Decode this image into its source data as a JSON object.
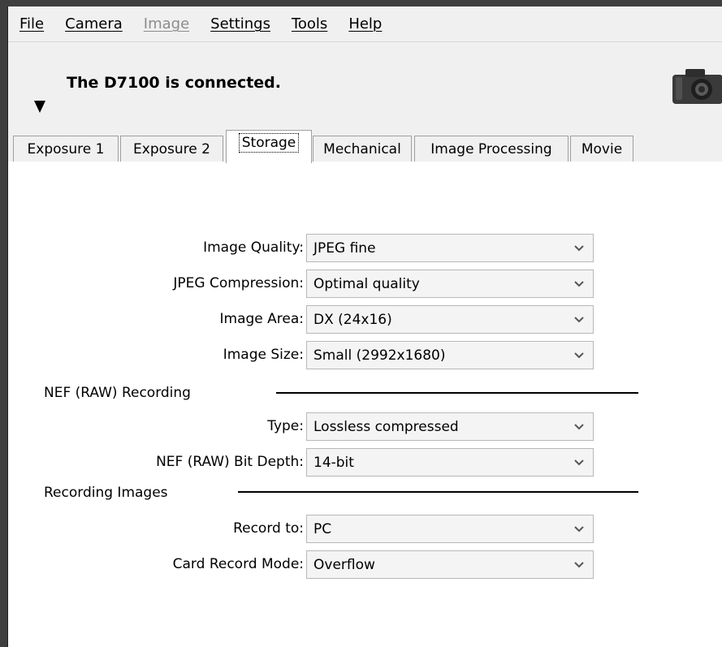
{
  "menu": {
    "items": [
      {
        "label": "File",
        "enabled": true
      },
      {
        "label": "Camera",
        "enabled": true
      },
      {
        "label": "Image",
        "enabled": false
      },
      {
        "label": "Settings",
        "enabled": true
      },
      {
        "label": "Tools",
        "enabled": true
      },
      {
        "label": "Help",
        "enabled": true
      }
    ]
  },
  "status": {
    "text": "The D7100 is connected.",
    "collapse_icon": "triangle-down-icon",
    "camera_icon": "camera-icon"
  },
  "tabs": [
    {
      "label": "Exposure 1",
      "active": false
    },
    {
      "label": "Exposure 2",
      "active": false
    },
    {
      "label": "Storage",
      "active": true
    },
    {
      "label": "Mechanical",
      "active": false
    },
    {
      "label": "Image Processing",
      "active": false
    },
    {
      "label": "Movie",
      "active": false
    }
  ],
  "storage": {
    "image_quality": {
      "label": "Image Quality:",
      "value": "JPEG fine"
    },
    "jpeg_compression": {
      "label": "JPEG Compression:",
      "value": "Optimal quality"
    },
    "image_area": {
      "label": "Image Area:",
      "value": "DX (24x16)"
    },
    "image_size": {
      "label": "Image Size:",
      "value": "Small (2992x1680)"
    },
    "nef_section": "NEF (RAW) Recording",
    "nef_type": {
      "label": "Type:",
      "value": "Lossless compressed"
    },
    "nef_bit_depth": {
      "label": "NEF (RAW) Bit Depth:",
      "value": "14-bit"
    },
    "recording_section": "Recording Images",
    "record_to": {
      "label": "Record to:",
      "value": "PC"
    },
    "card_record_mode": {
      "label": "Card Record Mode:",
      "value": "Overflow"
    }
  },
  "colors": {
    "window_bg": "#f0f0f0",
    "content_bg": "#ffffff",
    "frame_bg": "#3f3f3f",
    "disabled_text": "#8c8c8c"
  }
}
